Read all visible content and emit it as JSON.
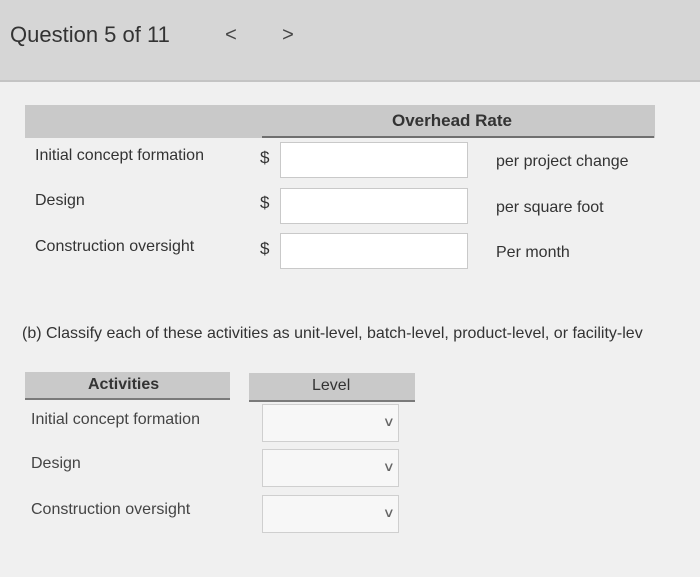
{
  "header": {
    "question_label": "Question 5 of 11",
    "prev_label": "<",
    "next_label": ">"
  },
  "overhead_table": {
    "column_header": "Overhead Rate",
    "currency_symbol": "$",
    "rows": [
      {
        "activity": "Initial concept formation",
        "value": "",
        "unit": "per project change"
      },
      {
        "activity": "Design",
        "value": "",
        "unit": "per square foot"
      },
      {
        "activity": "Construction oversight",
        "value": "",
        "unit": "Per month"
      }
    ]
  },
  "part_b": {
    "instruction": "(b) Classify each of these activities as unit-level, batch-level, product-level, or facility-lev"
  },
  "classification_table": {
    "activities_header": "Activities",
    "level_header": "Level",
    "rows": [
      {
        "activity": "Initial concept formation",
        "level": ""
      },
      {
        "activity": "Design",
        "level": ""
      },
      {
        "activity": "Construction oversight",
        "level": ""
      }
    ]
  },
  "icons": {
    "dropdown": "chevron-down-icon"
  }
}
